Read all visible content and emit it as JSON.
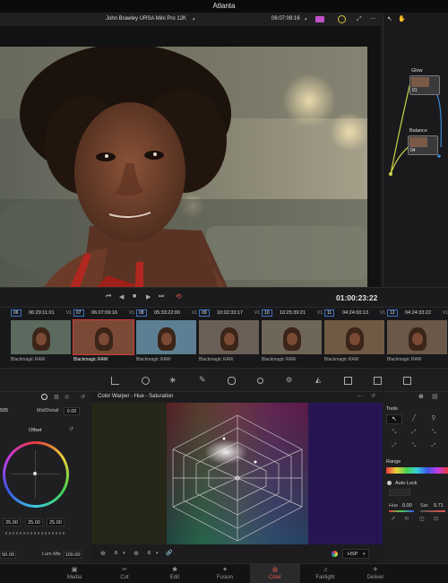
{
  "window": {
    "title": "Atlanta"
  },
  "viewer": {
    "camera_label": "John Brawley URSA Mini Pro 12K",
    "source_timecode": "06:07:09:16",
    "record_timecode": "01:00:23:22"
  },
  "nodes": [
    {
      "label": "Glow",
      "number": "01"
    },
    {
      "label": "Balance",
      "number": "04"
    }
  ],
  "timeline": {
    "clips": [
      {
        "num": "06",
        "tc": "06:29:11:01",
        "track": "V1",
        "name": "Blackmagic RAW",
        "selected": false
      },
      {
        "num": "07",
        "tc": "06:07:09:16",
        "track": "V1",
        "name": "Blackmagic RAW",
        "selected": true
      },
      {
        "num": "08",
        "tc": "05:33:22:00",
        "track": "V1",
        "name": "Blackmagic RAW",
        "selected": false
      },
      {
        "num": "09",
        "tc": "10:02:33:17",
        "track": "V1",
        "name": "Blackmagic RAW",
        "selected": false
      },
      {
        "num": "10",
        "tc": "10:25:39:21",
        "track": "V1",
        "name": "Blackmagic RAW",
        "selected": false
      },
      {
        "num": "11",
        "tc": "04:24:00:13",
        "track": "V1",
        "name": "Blackmagic RAW",
        "selected": false
      },
      {
        "num": "12",
        "tc": "04:24:33:22",
        "track": "V1",
        "name": "Blackmagic RAW",
        "selected": false
      }
    ]
  },
  "left_panel": {
    "top_value": "935",
    "mid_detail_label": "Mid/Detail",
    "mid_detail_value": "0.00",
    "wheel_label": "Offset",
    "values": [
      "25.00",
      "25.00",
      "25.00"
    ],
    "bottom_left_value": "50.00",
    "lum_mix_label": "Lum Mix",
    "lum_mix_value": "100.00"
  },
  "warper": {
    "title": "Color Warper - Hue - Saturation",
    "res1": "6",
    "res2": "6",
    "color_space": "HSP"
  },
  "right_panel": {
    "tools_label": "Tools",
    "range_label": "Range",
    "auto_lock_label": "Auto Lock",
    "hue_label": "Hue",
    "hue_value": "0.00",
    "sat_label": "Sat",
    "sat_value": "0.71"
  },
  "pages": [
    {
      "label": "Media",
      "icon": "media-icon",
      "active": false
    },
    {
      "label": "Cut",
      "icon": "cut-icon",
      "active": false
    },
    {
      "label": "Edit",
      "icon": "edit-icon",
      "active": false
    },
    {
      "label": "Fusion",
      "icon": "fusion-icon",
      "active": false
    },
    {
      "label": "Color",
      "icon": "color-icon",
      "active": true
    },
    {
      "label": "Fairlight",
      "icon": "fairlight-icon",
      "active": false
    },
    {
      "label": "Deliver",
      "icon": "deliver-icon",
      "active": false
    }
  ],
  "colors": {
    "accent": "#e8574a",
    "clip_selected": "#d23a3a",
    "node_link": "#c8d34a"
  }
}
